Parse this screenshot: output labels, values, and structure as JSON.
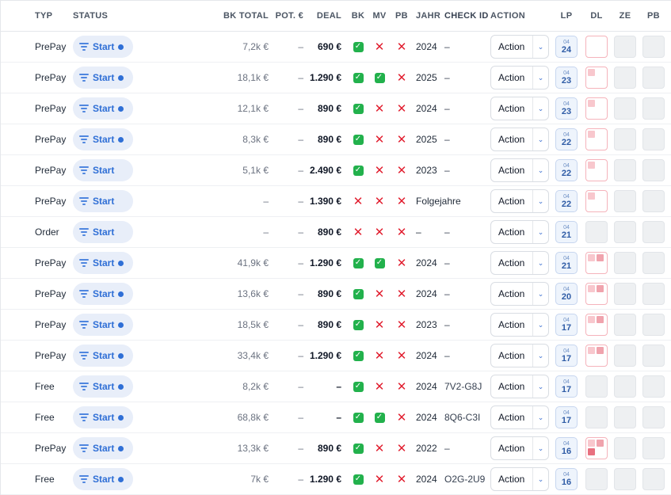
{
  "header": {
    "typ": "TYP",
    "status": "STATUS",
    "bk_total": "BK TOTAL",
    "pot": "POT. €",
    "deal": "DEAL",
    "bk": "BK",
    "mv": "MV",
    "pb": "PB",
    "jahr": "JAHR",
    "check_id": "CHECK ID",
    "action": "ACTION",
    "lp": "LP",
    "dl": "DL",
    "ze": "ZE",
    "pb2": "PB"
  },
  "colors": {
    "accent": "#2f6fd6",
    "check": "#22b14c",
    "cross": "#e11d2e",
    "dl_border": "#f5b3bb"
  },
  "rows": [
    {
      "typ": "PrePay",
      "status": "Start",
      "status_dot": true,
      "bk_total": "7,2k €",
      "pot": "–",
      "deal": "690 €",
      "bk": true,
      "mv": false,
      "pb": false,
      "jahr": "2024",
      "check_id": "–",
      "action": "Action",
      "lp_month": "04",
      "lp_day": "24",
      "dl": "box",
      "dl_marks": []
    },
    {
      "typ": "PrePay",
      "status": "Start",
      "status_dot": true,
      "bk_total": "18,1k €",
      "pot": "–",
      "deal": "1.290 €",
      "bk": true,
      "mv": true,
      "pb": false,
      "jahr": "2025",
      "check_id": "–",
      "action": "Action",
      "lp_month": "04",
      "lp_day": "23",
      "dl": "box",
      "dl_marks": [
        "light"
      ]
    },
    {
      "typ": "PrePay",
      "status": "Start",
      "status_dot": true,
      "bk_total": "12,1k €",
      "pot": "–",
      "deal": "890 €",
      "bk": true,
      "mv": false,
      "pb": false,
      "jahr": "2024",
      "check_id": "–",
      "action": "Action",
      "lp_month": "04",
      "lp_day": "23",
      "dl": "box",
      "dl_marks": [
        "light"
      ]
    },
    {
      "typ": "PrePay",
      "status": "Start",
      "status_dot": true,
      "bk_total": "8,3k €",
      "pot": "–",
      "deal": "890 €",
      "bk": true,
      "mv": false,
      "pb": false,
      "jahr": "2025",
      "check_id": "–",
      "action": "Action",
      "lp_month": "04",
      "lp_day": "22",
      "dl": "box",
      "dl_marks": [
        "light"
      ]
    },
    {
      "typ": "PrePay",
      "status": "Start",
      "status_dot": false,
      "bk_total": "5,1k €",
      "pot": "–",
      "deal": "2.490 €",
      "bk": true,
      "mv": false,
      "pb": false,
      "jahr": "2023",
      "check_id": "–",
      "action": "Action",
      "lp_month": "04",
      "lp_day": "22",
      "dl": "box",
      "dl_marks": [
        "light"
      ]
    },
    {
      "typ": "PrePay",
      "status": "Start",
      "status_dot": false,
      "bk_total": "–",
      "pot": "–",
      "deal": "1.390 €",
      "bk": false,
      "mv": false,
      "pb": false,
      "jahr": "Folgejahre",
      "check_id": "",
      "action": "Action",
      "lp_month": "04",
      "lp_day": "22",
      "dl": "box",
      "dl_marks": [
        "light"
      ]
    },
    {
      "typ": "Order",
      "status": "Start",
      "status_dot": false,
      "bk_total": "–",
      "pot": "–",
      "deal": "890 €",
      "bk": false,
      "mv": false,
      "pb": false,
      "jahr": "–",
      "check_id": "–",
      "action": "Action",
      "lp_month": "04",
      "lp_day": "21",
      "dl": "empty",
      "dl_marks": []
    },
    {
      "typ": "PrePay",
      "status": "Start",
      "status_dot": true,
      "bk_total": "41,9k €",
      "pot": "–",
      "deal": "1.290 €",
      "bk": true,
      "mv": true,
      "pb": false,
      "jahr": "2024",
      "check_id": "–",
      "action": "Action",
      "lp_month": "04",
      "lp_day": "21",
      "dl": "box",
      "dl_marks": [
        "light",
        "mid"
      ]
    },
    {
      "typ": "PrePay",
      "status": "Start",
      "status_dot": true,
      "bk_total": "13,6k €",
      "pot": "–",
      "deal": "890 €",
      "bk": true,
      "mv": false,
      "pb": false,
      "jahr": "2024",
      "check_id": "–",
      "action": "Action",
      "lp_month": "04",
      "lp_day": "20",
      "dl": "box",
      "dl_marks": [
        "light",
        "mid"
      ]
    },
    {
      "typ": "PrePay",
      "status": "Start",
      "status_dot": true,
      "bk_total": "18,5k €",
      "pot": "–",
      "deal": "890 €",
      "bk": true,
      "mv": false,
      "pb": false,
      "jahr": "2023",
      "check_id": "–",
      "action": "Action",
      "lp_month": "04",
      "lp_day": "17",
      "dl": "box",
      "dl_marks": [
        "light",
        "mid"
      ]
    },
    {
      "typ": "PrePay",
      "status": "Start",
      "status_dot": true,
      "bk_total": "33,4k €",
      "pot": "–",
      "deal": "1.290 €",
      "bk": true,
      "mv": false,
      "pb": false,
      "jahr": "2024",
      "check_id": "–",
      "action": "Action",
      "lp_month": "04",
      "lp_day": "17",
      "dl": "box",
      "dl_marks": [
        "light",
        "mid"
      ]
    },
    {
      "typ": "Free",
      "status": "Start",
      "status_dot": true,
      "bk_total": "8,2k €",
      "pot": "–",
      "deal": "–",
      "bk": true,
      "mv": false,
      "pb": false,
      "jahr": "2024",
      "check_id": "7V2-G8J",
      "action": "Action",
      "lp_month": "04",
      "lp_day": "17",
      "dl": "empty",
      "dl_marks": []
    },
    {
      "typ": "Free",
      "status": "Start",
      "status_dot": true,
      "bk_total": "68,8k €",
      "pot": "–",
      "deal": "–",
      "bk": true,
      "mv": true,
      "pb": false,
      "jahr": "2024",
      "check_id": "8Q6-C3I",
      "action": "Action",
      "lp_month": "04",
      "lp_day": "17",
      "dl": "empty",
      "dl_marks": []
    },
    {
      "typ": "PrePay",
      "status": "Start",
      "status_dot": true,
      "bk_total": "13,3k €",
      "pot": "–",
      "deal": "890 €",
      "bk": true,
      "mv": false,
      "pb": false,
      "jahr": "2022",
      "check_id": "–",
      "action": "Action",
      "lp_month": "04",
      "lp_day": "16",
      "dl": "box",
      "dl_marks": [
        "light",
        "mid",
        "dark"
      ]
    },
    {
      "typ": "Free",
      "status": "Start",
      "status_dot": true,
      "bk_total": "7k €",
      "pot": "–",
      "deal": "1.290 €",
      "bk": true,
      "mv": false,
      "pb": false,
      "jahr": "2024",
      "check_id": "O2G-2U9",
      "action": "Action",
      "lp_month": "04",
      "lp_day": "16",
      "dl": "empty",
      "dl_marks": []
    }
  ]
}
